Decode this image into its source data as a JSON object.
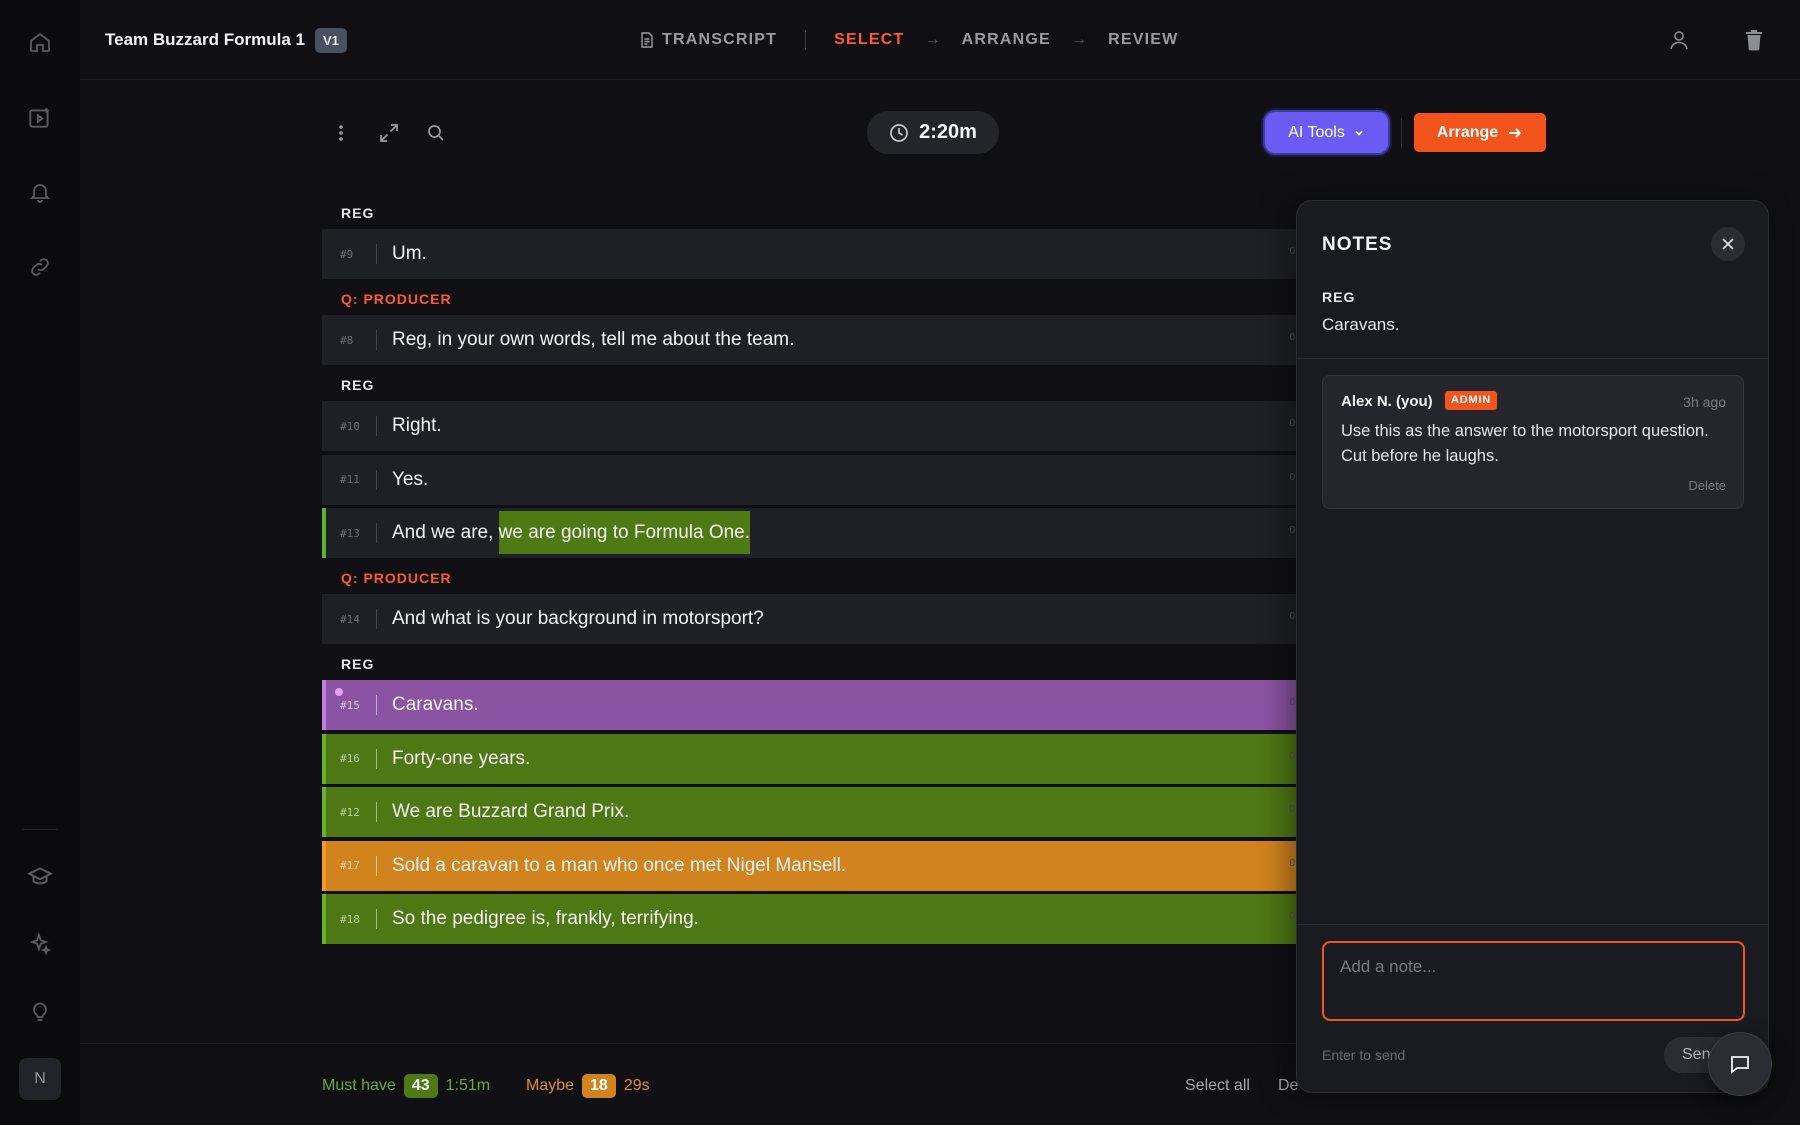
{
  "app": {
    "project_title": "Team Buzzard Formula 1",
    "version": "V1"
  },
  "steps": [
    {
      "label": "TRANSCRIPT",
      "icon": "document-icon",
      "active": false
    },
    {
      "label": "SELECT",
      "active": true
    },
    {
      "label": "ARRANGE",
      "active": false
    },
    {
      "label": "REVIEW",
      "active": false
    }
  ],
  "rail": {
    "icons": [
      "home-icon",
      "video-icon",
      "bell-icon",
      "link-icon",
      "graduation-cap-icon",
      "sparkle-icon",
      "lightbulb-icon"
    ],
    "avatar": "N"
  },
  "header_icons": [
    "user-icon",
    "trash-icon"
  ],
  "toolbar": {
    "timer": "2:20m",
    "ai_tools_label": "AI Tools",
    "arrange_label": "Arrange"
  },
  "transcript": [
    {
      "speaker": "REG",
      "question": false,
      "lines": [
        {
          "num": "#9",
          "text": "Um.",
          "tail": "0",
          "state": "none"
        }
      ]
    },
    {
      "speaker": "Q: PRODUCER",
      "question": true,
      "lines": [
        {
          "num": "#8",
          "text": "Reg, in your own words, tell me about the team.",
          "tail": "0",
          "state": "none"
        }
      ]
    },
    {
      "speaker": "REG",
      "question": false,
      "lines": [
        {
          "num": "#10",
          "text": "Right.",
          "tail": "0",
          "state": "none"
        },
        {
          "num": "#11",
          "text": "Yes.",
          "tail": "0",
          "state": "none"
        },
        {
          "num": "#13",
          "text_before": "And we are, ",
          "text_highlight": "we are going to Formula One.",
          "tail": "0",
          "state": "partial-must-have"
        }
      ]
    },
    {
      "speaker": "Q: PRODUCER",
      "question": true,
      "lines": [
        {
          "num": "#14",
          "text": "And what is your background in motorsport?",
          "tail": "0",
          "state": "none"
        }
      ]
    },
    {
      "speaker": "REG",
      "question": false,
      "lines": [
        {
          "num": "#15",
          "text": "Caravans.",
          "tail": "0",
          "state": "noted"
        },
        {
          "num": "#16",
          "text": "Forty-one years.",
          "tail": "0",
          "state": "must-have"
        },
        {
          "num": "#12",
          "text": "We are Buzzard Grand Prix.",
          "tail": "0",
          "state": "must-have"
        },
        {
          "num": "#17",
          "text": "Sold a caravan to a man who once met Nigel Mansell.",
          "tail": "0",
          "state": "maybe"
        },
        {
          "num": "#18",
          "text": "So the pedigree is, frankly, terrifying.",
          "tail": "0",
          "state": "must-have"
        }
      ]
    }
  ],
  "footer": {
    "must_have_label": "Must have",
    "must_have_count": "43",
    "must_have_time": "1:51m",
    "maybe_label": "Maybe",
    "maybe_count": "18",
    "maybe_time": "29s",
    "select_all": "Select all",
    "deselect_partial": "De"
  },
  "notes": {
    "title": "NOTES",
    "speaker": "REG",
    "quote": "Caravans.",
    "comments": [
      {
        "author": "Alex N. (you)",
        "badge": "ADMIN",
        "time": "3h ago",
        "body": "Use this as the answer to the motorsport question. Cut before he laughs.",
        "delete_label": "Delete"
      }
    ],
    "input_placeholder": "Add a note...",
    "hint": "Enter to send",
    "send_label": "Send"
  },
  "colors": {
    "accent": "#ff5a2c",
    "must_have": "#4e7813",
    "maybe": "#d1831e",
    "noted": "#8a54a2",
    "ai_tools": "#6a5cf3"
  }
}
